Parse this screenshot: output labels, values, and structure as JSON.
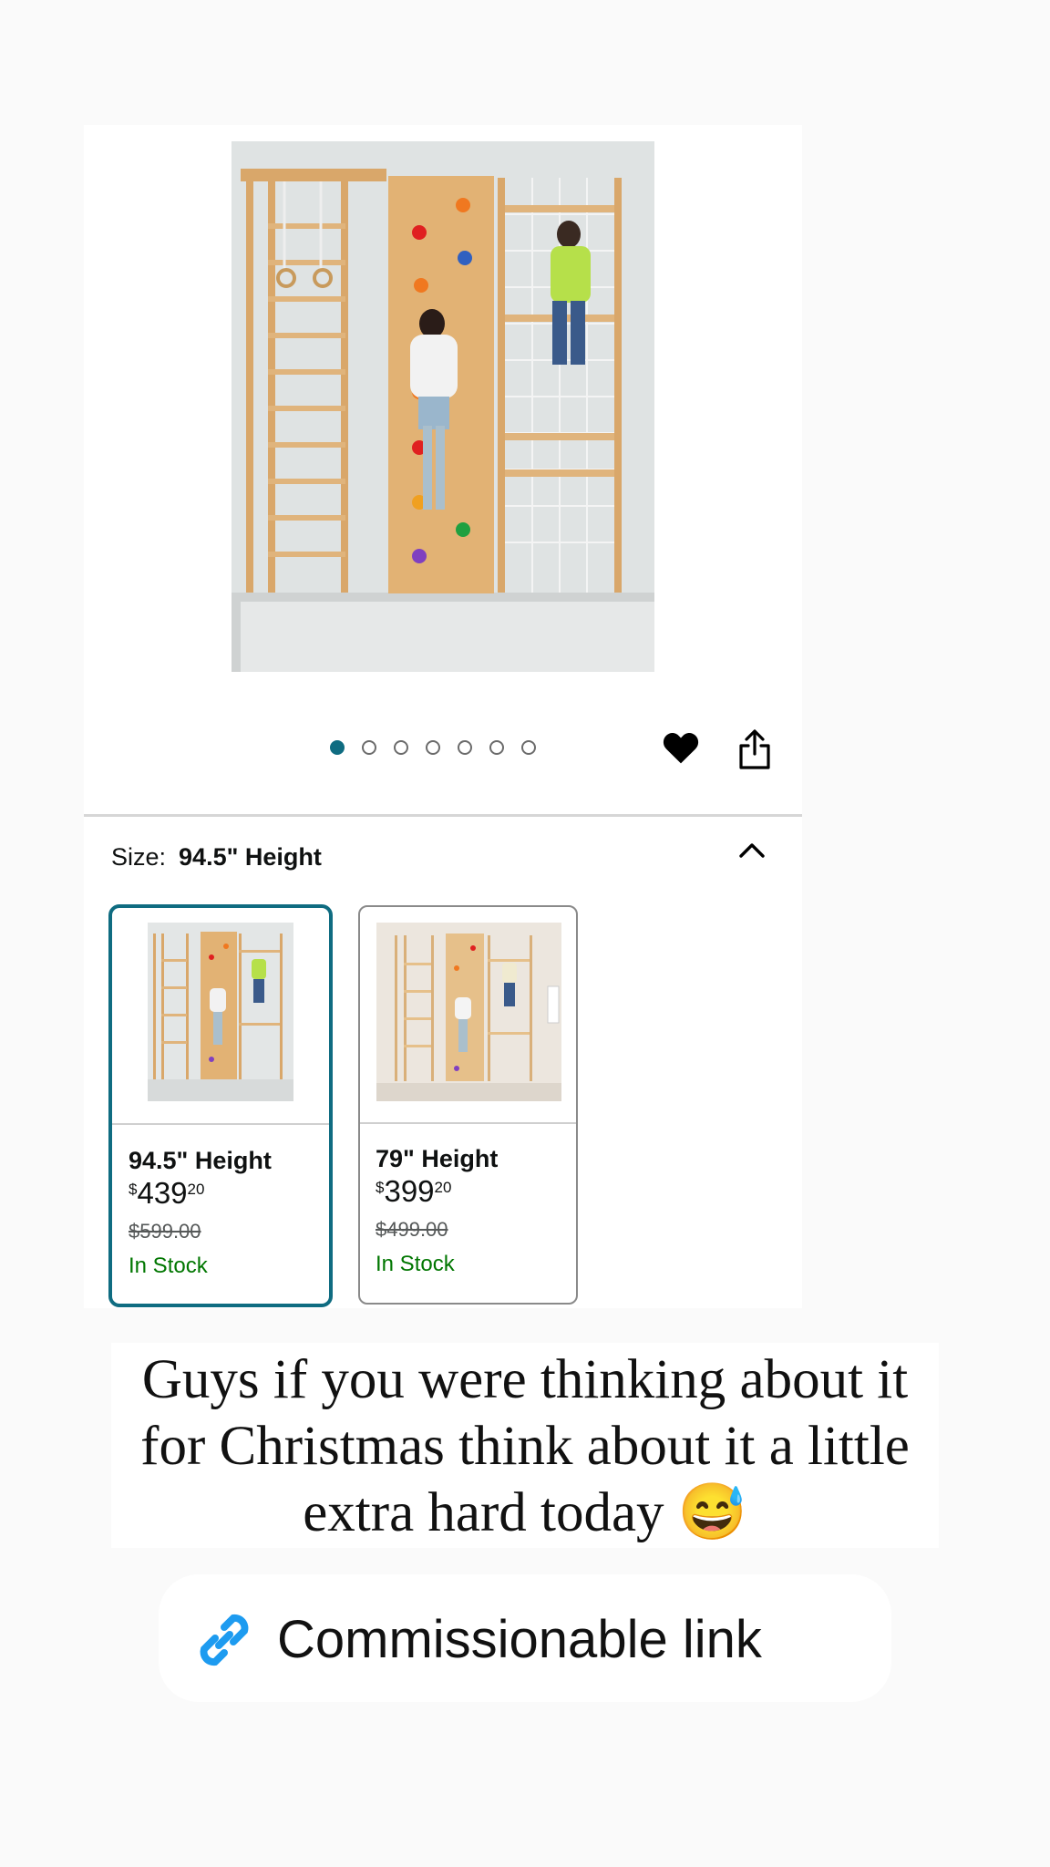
{
  "gallery": {
    "image_alt": "Wooden indoor climbing wall with ladders, rope net and gymnastic rings with two children climbing",
    "dot_count": 7,
    "active_dot": 1,
    "favorite_icon": "heart-icon",
    "share_icon": "share-icon"
  },
  "size_selector": {
    "label": "Size:",
    "selected_value": "94.5\" Height",
    "collapse_icon": "chevron-up-icon",
    "options": [
      {
        "title": "94.5\" Height",
        "price_symbol": "$",
        "price_whole": "439",
        "price_cents": "20",
        "list_price": "$599.00",
        "availability": "In Stock",
        "selected": true
      },
      {
        "title": "79\" Height",
        "price_symbol": "$",
        "price_whole": "399",
        "price_cents": "20",
        "list_price": "$499.00",
        "availability": "In Stock",
        "selected": false
      }
    ]
  },
  "caption": {
    "text": "Guys if you were thinking about it for Christmas think about it a little extra hard today 😅"
  },
  "link_sticker": {
    "icon": "link-icon",
    "label": "Commissionable link"
  },
  "colors": {
    "accent": "#0f6c81",
    "in_stock": "#007600",
    "link_blue": "#1d9bf0"
  }
}
